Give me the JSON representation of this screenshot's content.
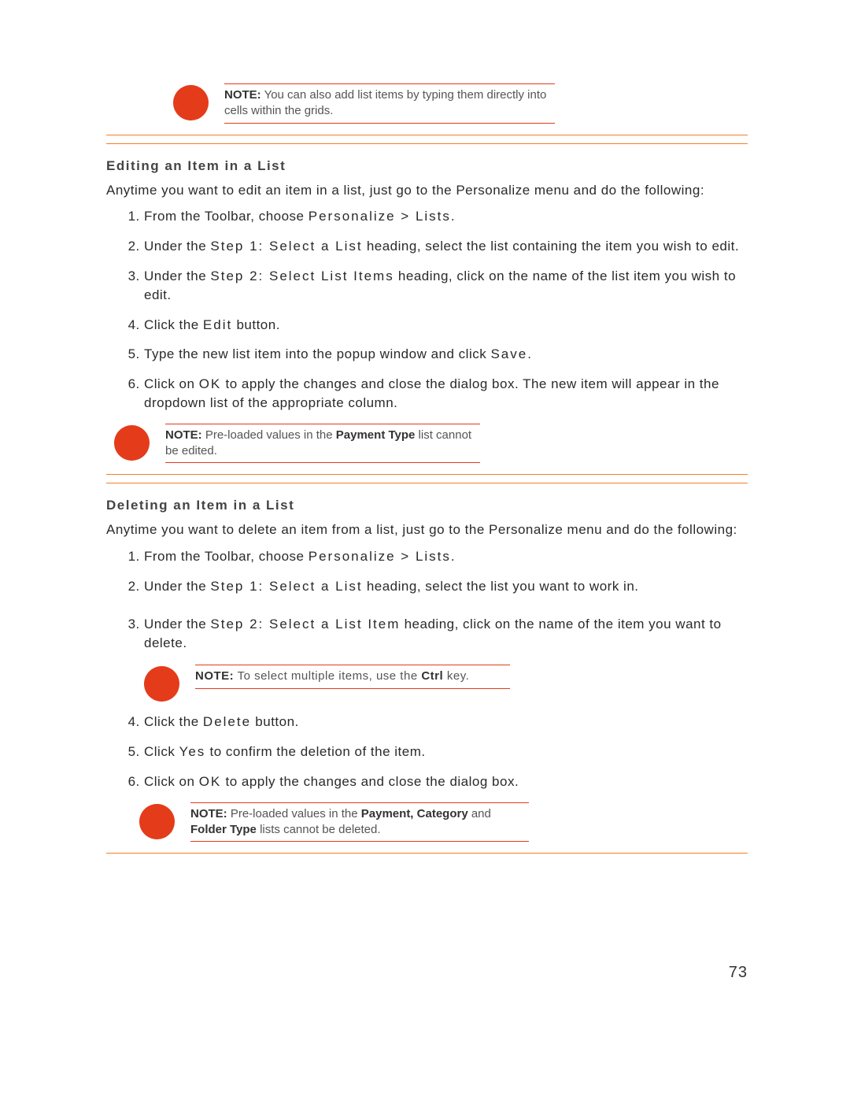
{
  "topNote": {
    "prefix": "NOTE:",
    "text": " You can also add list items by typing them directly into cells within the grids."
  },
  "edit": {
    "heading": "Editing an Item in a List",
    "intro": "Anytime you want to edit an item in a list, just go to the Personalize menu and do the following:",
    "steps": {
      "s1_a": "From the Toolbar, choose ",
      "s1_b": "Personalize > Lists",
      "s1_c": ".",
      "s2_a": "Under the ",
      "s2_b": "Step 1: Select a List",
      "s2_c": " heading, select the list containing the item you wish to edit.",
      "s3_a": "Under the ",
      "s3_b": "Step 2: Select List Items",
      "s3_c": " heading, click on the name of the list item you wish to edit.",
      "s4_a": "Click the ",
      "s4_b": "Edit",
      "s4_c": " button.",
      "s5_a": "Type the new list item into the popup window and click ",
      "s5_b": "Save",
      "s5_c": ".",
      "s6_a": "Click on ",
      "s6_b": "OK",
      "s6_c": " to apply the changes and close the dialog box. The new item will appear in the dropdown list of the appropriate column."
    },
    "note": {
      "prefix": "NOTE:",
      "a": " Pre-loaded values in the ",
      "b": "Payment Type",
      "c": " list cannot be edited."
    }
  },
  "del": {
    "heading": "Deleting an Item in a List",
    "intro": "Anytime you want to delete an item from a list, just go to the Personalize menu and do the following:",
    "steps": {
      "s1_a": "From the Toolbar, choose ",
      "s1_b": "Personalize > Lists",
      "s1_c": ".",
      "s2_a": "Under the ",
      "s2_b": "Step 1: Select a List",
      "s2_c": " heading, select the list you want to work in.",
      "s3_a": "Under the ",
      "s3_b": "Step 2: Select a List Item",
      "s3_c": " heading, click on the name of the item you want to delete.",
      "noteMid": {
        "prefix": "NOTE:",
        "a": " To select multiple items, use the ",
        "b": "Ctrl",
        "c": " key."
      },
      "s4_a": "Click the ",
      "s4_b": "Delete",
      "s4_c": " button.",
      "s5_a": "Click ",
      "s5_b": "Yes",
      "s5_c": " to confirm the deletion of the item.",
      "s6_a": "Click on ",
      "s6_b": "OK",
      "s6_c": " to apply the changes and close the dialog box."
    },
    "note": {
      "prefix": "NOTE:",
      "a": " Pre-loaded values in the ",
      "b": "Payment, Category",
      "c": " and ",
      "d": "Folder Type",
      "e": " lists cannot be deleted."
    }
  },
  "pageNumber": "73"
}
